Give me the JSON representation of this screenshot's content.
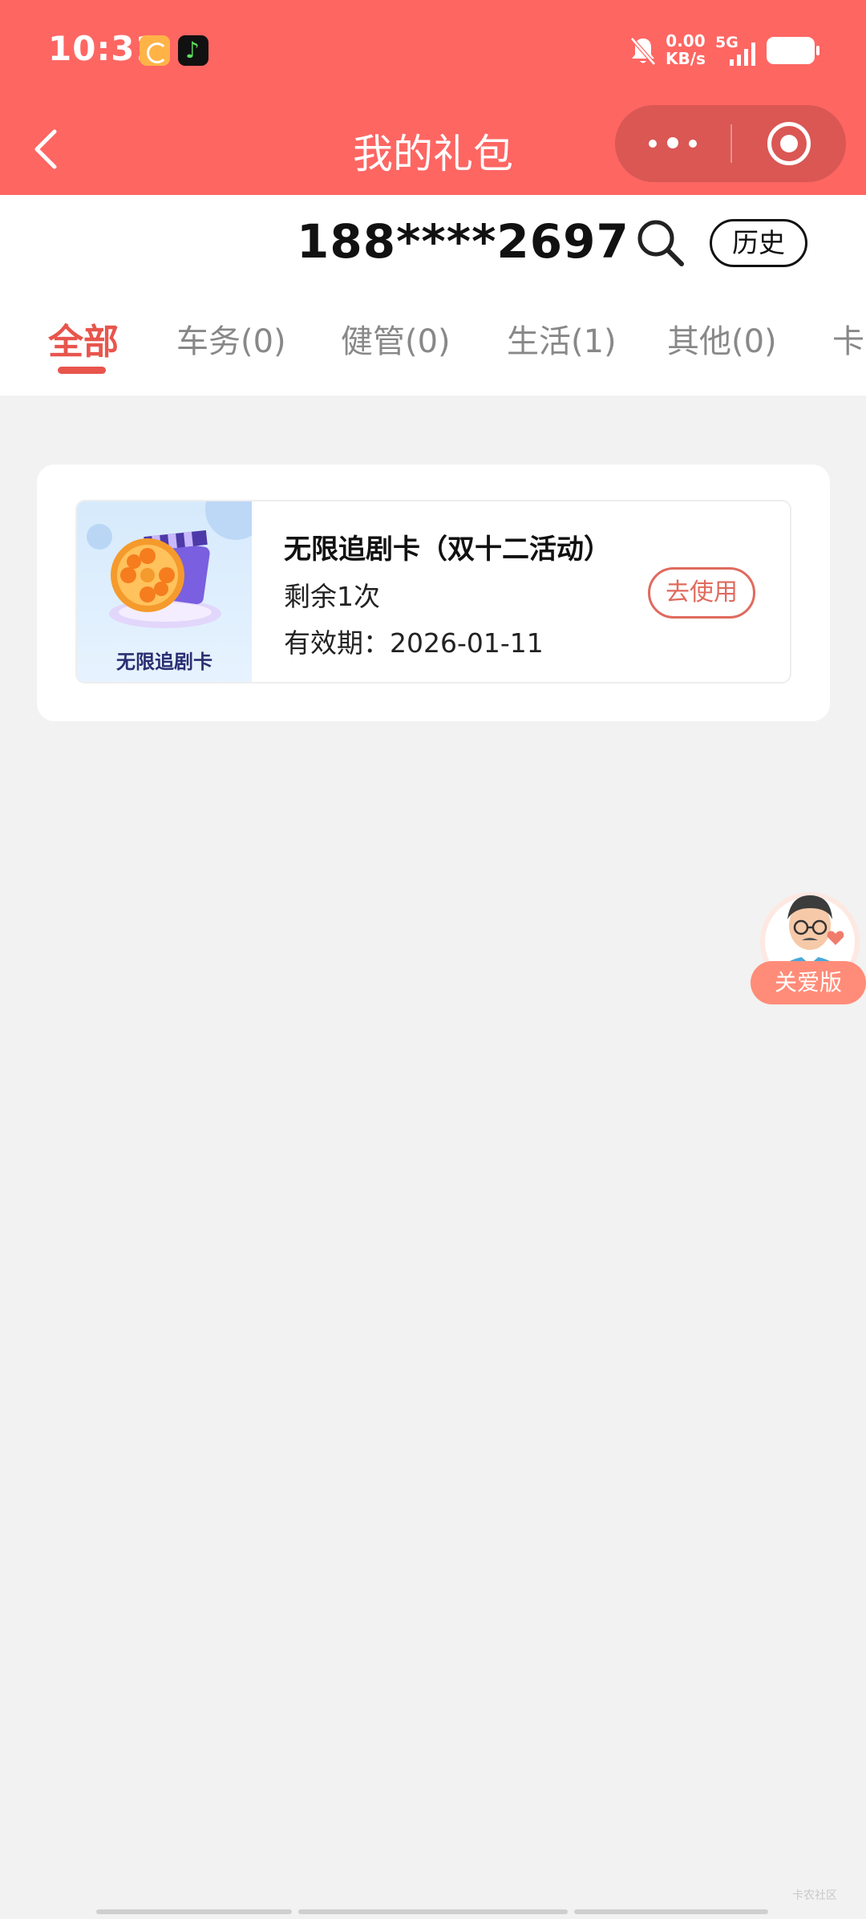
{
  "status_bar": {
    "time": "10:31",
    "net_speed_value": "0.00",
    "net_speed_unit": "KB/s",
    "network": "5G",
    "icons": [
      "phone-app-icon",
      "music-app-icon",
      "bell-muted-icon",
      "signal-icon",
      "battery-icon"
    ]
  },
  "header": {
    "title": "我的礼包",
    "back_icon": "chevron-left-icon",
    "more_icon": "more-dots-icon",
    "close_icon": "target-circle-icon",
    "bg_color": "#fe6662"
  },
  "account": {
    "phone": "188****2697",
    "history_label": "历史"
  },
  "tabs": [
    {
      "label": "全部",
      "active": true
    },
    {
      "label": "车务(0)",
      "active": false
    },
    {
      "label": "健管(0)",
      "active": false
    },
    {
      "label": "生活(1)",
      "active": false
    },
    {
      "label": "其他(0)",
      "active": false
    },
    {
      "label": "卡",
      "active": false
    }
  ],
  "gifts": [
    {
      "image_label": "无限追剧卡",
      "name": "无限追剧卡（双十二活动）",
      "remaining": "剩余1次",
      "validity": "有效期：2026-01-11",
      "action_label": "去使用"
    }
  ],
  "care_mode": {
    "label": "关爱版"
  },
  "watermark": "卡农社区",
  "colors": {
    "accent": "#e8554c",
    "button_outline": "#e06a5e",
    "page_bg": "#f2f2f2"
  }
}
